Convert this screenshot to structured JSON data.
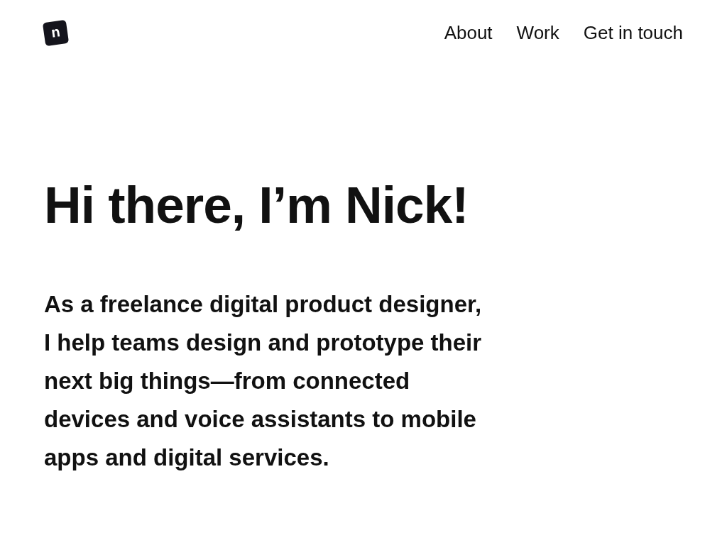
{
  "header": {
    "logo": {
      "letter": "n"
    },
    "nav": [
      {
        "label": "About"
      },
      {
        "label": "Work"
      },
      {
        "label": "Get in touch"
      }
    ]
  },
  "hero": {
    "heading": "Hi there, I’m Nick!",
    "intro": "As a freelance digital product designer, I help teams design and prototype their next big things—from connected devices and voice assistants to mobile apps and digital services."
  }
}
